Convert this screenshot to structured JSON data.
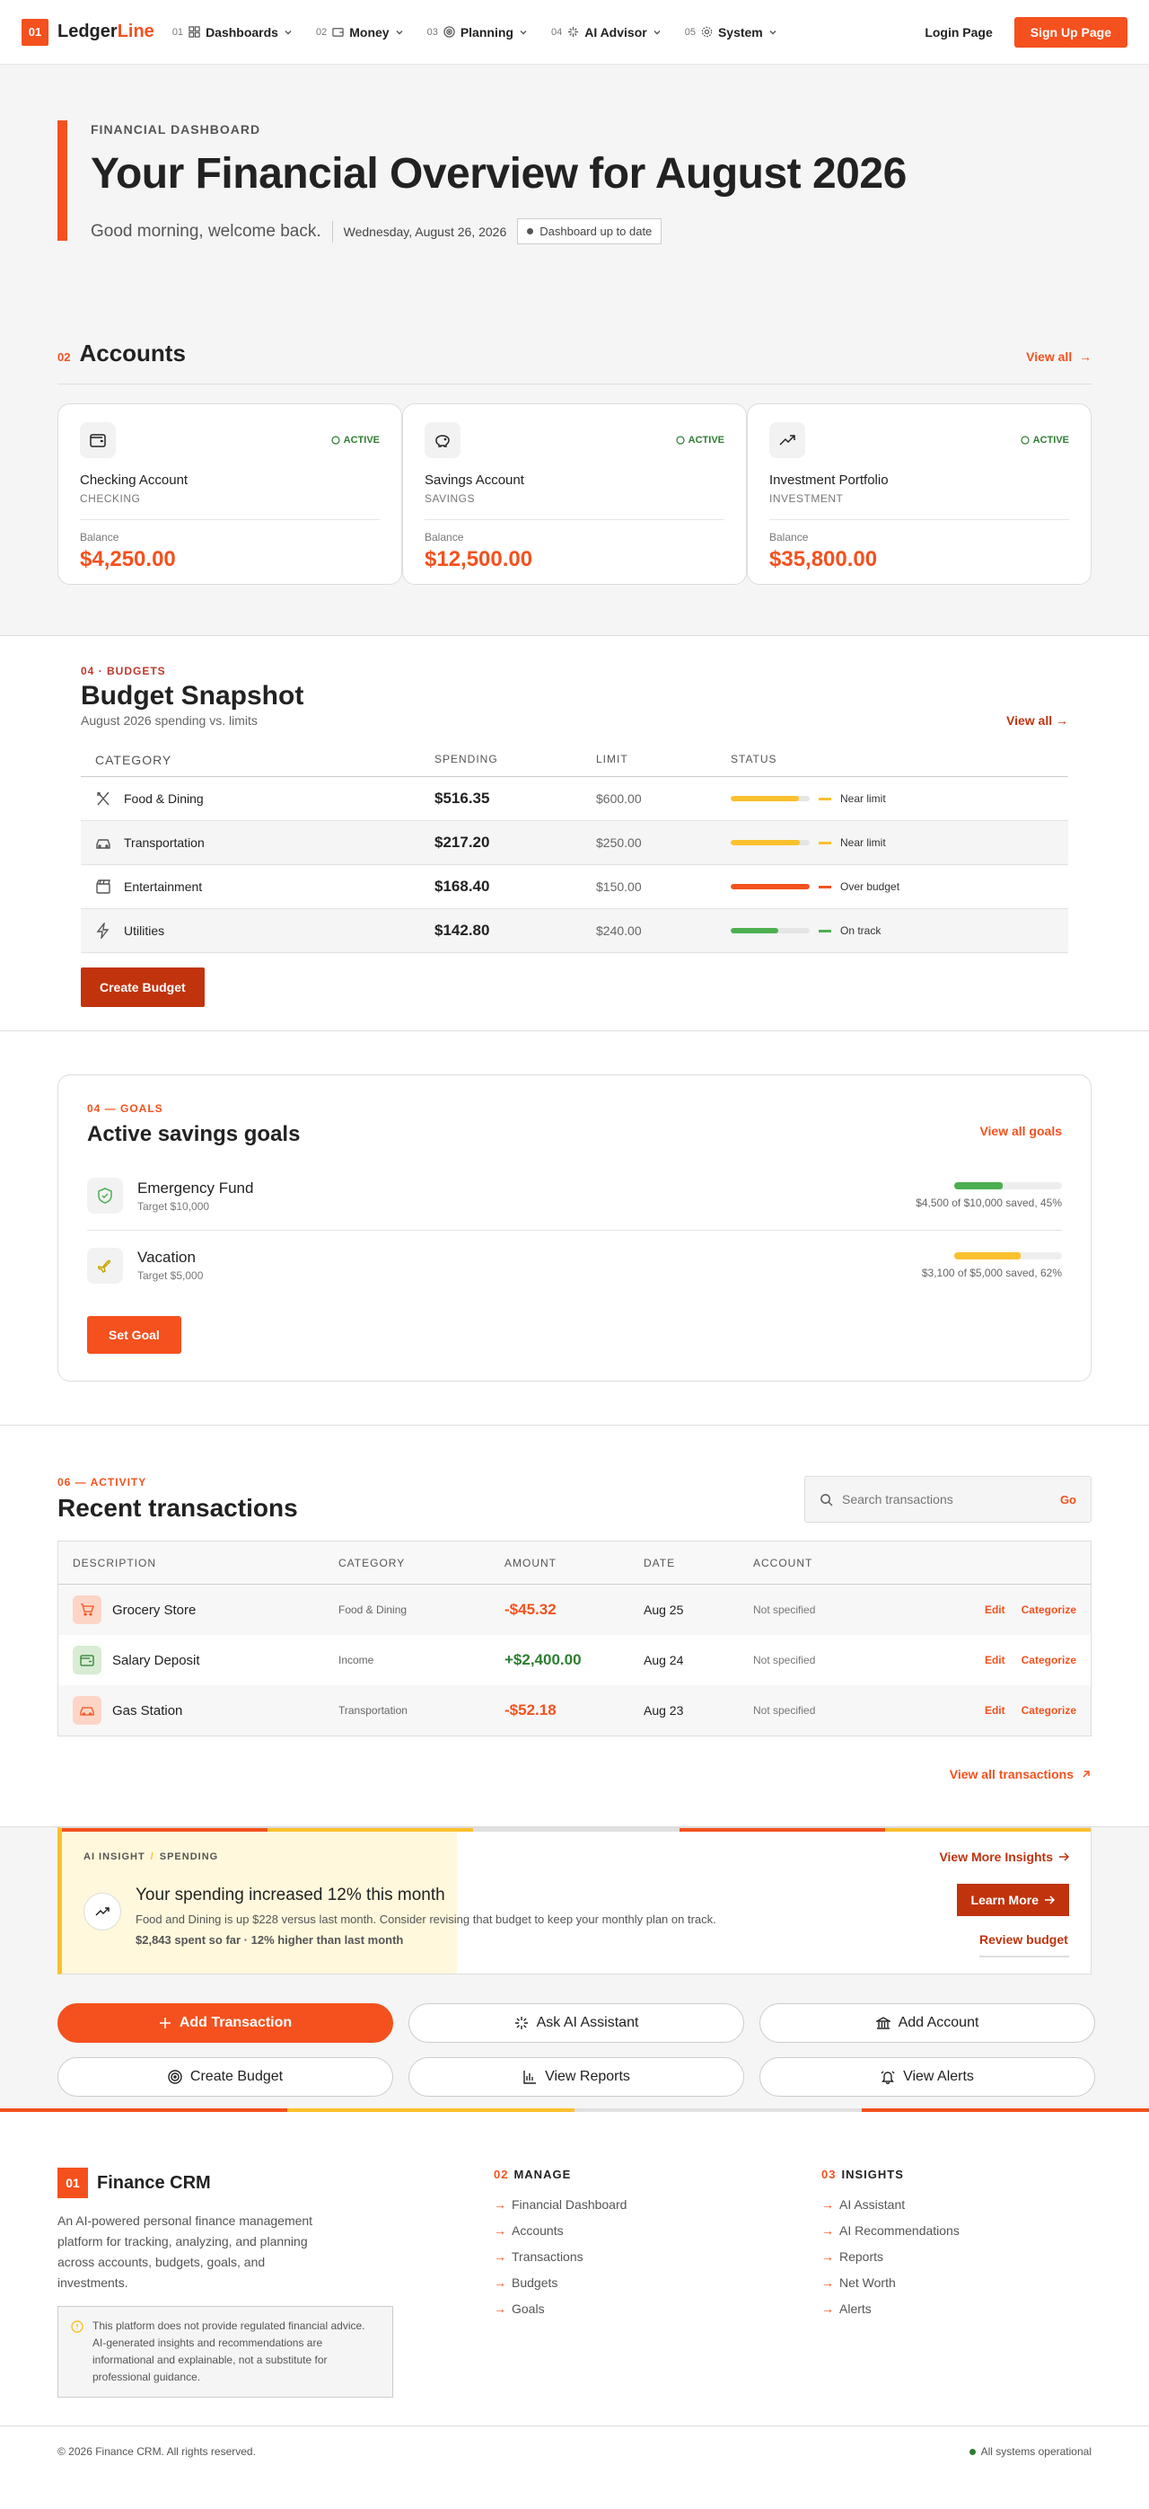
{
  "nav": {
    "logo_badge": "01",
    "logo_a": "Ledger",
    "logo_b": "Line",
    "items": [
      {
        "num": "01",
        "label": "Dashboards"
      },
      {
        "num": "02",
        "label": "Money"
      },
      {
        "num": "03",
        "label": "Planning"
      },
      {
        "num": "04",
        "label": "AI Advisor"
      },
      {
        "num": "05",
        "label": "System"
      }
    ],
    "login": "Login Page",
    "signup": "Sign Up Page"
  },
  "hero": {
    "eyebrow": "FINANCIAL DASHBOARD",
    "title": "Your Financial Overview for August 2026",
    "greeting": "Good morning, welcome back.",
    "date": "Wednesday, August 26, 2026",
    "chip": "Dashboard up to date"
  },
  "accounts": {
    "num": "02",
    "title": "Accounts",
    "view_all": "View all",
    "balance_label": "Balance",
    "status": "ACTIVE",
    "items": [
      {
        "name": "Checking Account",
        "type": "CHECKING",
        "balance": "$4,250.00"
      },
      {
        "name": "Savings Account",
        "type": "SAVINGS",
        "balance": "$12,500.00"
      },
      {
        "name": "Investment Portfolio",
        "type": "INVESTMENT",
        "balance": "$35,800.00"
      }
    ]
  },
  "budgets": {
    "eyebrow": "04 · BUDGETS",
    "title": "Budget Snapshot",
    "subtitle": "August 2026 spending vs. limits",
    "view_all": "View all →",
    "headers": [
      "CATEGORY",
      "SPENDING",
      "LIMIT",
      "STATUS"
    ],
    "rows": [
      {
        "category": "Food & Dining",
        "spending": "$516.35",
        "limit": "$600.00",
        "status": "Near limit",
        "progress": 0.86,
        "color": "#fbc02d"
      },
      {
        "category": "Transportation",
        "spending": "$217.20",
        "limit": "$250.00",
        "status": "Near limit",
        "progress": 0.87,
        "color": "#fbc02d"
      },
      {
        "category": "Entertainment",
        "spending": "$168.40",
        "limit": "$150.00",
        "status": "Over budget",
        "progress": 1.0,
        "color": "#f4511e"
      },
      {
        "category": "Utilities",
        "spending": "$142.80",
        "limit": "$240.00",
        "status": "On track",
        "progress": 0.6,
        "color": "#4caf50"
      }
    ],
    "create_button": "Create Budget"
  },
  "goals": {
    "eyebrow": "04 — GOALS",
    "title": "Active savings goals",
    "view_all": "View all goals",
    "items": [
      {
        "name": "Emergency Fund",
        "target": "Target $10,000",
        "note": "$4,500 of $10,000 saved, 45%",
        "progress": 0.45,
        "color": "#4caf50"
      },
      {
        "name": "Vacation",
        "target": "Target $5,000",
        "note": "$3,100 of $5,000 saved, 62%",
        "progress": 0.62,
        "color": "#fbc02d"
      }
    ],
    "set_button": "Set Goal"
  },
  "transactions": {
    "eyebrow": "06 — ACTIVITY",
    "title": "Recent transactions",
    "search_placeholder": "Search transactions",
    "go": "Go",
    "headers": [
      "DESCRIPTION",
      "CATEGORY",
      "AMOUNT",
      "DATE",
      "ACCOUNT"
    ],
    "rows": [
      {
        "desc": "Grocery Store",
        "category": "Food & Dining",
        "amount": "-$45.32",
        "date": "Aug 25",
        "account": "Not specified"
      },
      {
        "desc": "Salary Deposit",
        "category": "Income",
        "amount": "+$2,400.00",
        "date": "Aug 24",
        "account": "Not specified"
      },
      {
        "desc": "Gas Station",
        "category": "Transportation",
        "amount": "-$52.18",
        "date": "Aug 23",
        "account": "Not specified"
      }
    ],
    "edit": "Edit",
    "categorize": "Categorize",
    "view_all": "View all transactions"
  },
  "insight": {
    "label": "AI INSIGHT",
    "divider": "/",
    "tag": "SPENDING",
    "title": "Your spending increased 12% this month",
    "text": "Food and Dining is up $228 versus last month. Consider revising that budget to keep your monthly plan on track.",
    "footnote": "$2,843 spent so far · 12% higher than last month",
    "more": "View More Insights",
    "learn": "Learn More",
    "review": "Review budget"
  },
  "quick_actions": [
    "Add Transaction",
    "Ask AI Assistant",
    "Add Account",
    "Create Budget",
    "View Reports",
    "View Alerts"
  ],
  "footer": {
    "badge": "01",
    "name": "Finance CRM",
    "desc": "An AI-powered personal finance management platform for tracking, analyzing, and planning across accounts, budgets, goals, and investments.",
    "note": "This platform does not provide regulated financial advice. AI-generated insights and recommendations are informational and explainable, not a substitute for professional guidance.",
    "manage_num": "02",
    "manage_title": "MANAGE",
    "manage": [
      "Financial Dashboard",
      "Accounts",
      "Transactions",
      "Budgets",
      "Goals"
    ],
    "insights_num": "03",
    "insights_title": "INSIGHTS",
    "insights": [
      "AI Assistant",
      "AI Recommendations",
      "Reports",
      "Net Worth",
      "Alerts"
    ],
    "copyright": "© 2026 Finance CRM. All rights reserved.",
    "status": "All systems operational"
  },
  "colors": {
    "accent": "#f4511e",
    "dark_accent": "#c0330d",
    "warning": "#fbc02d",
    "success": "#2e7d32"
  }
}
